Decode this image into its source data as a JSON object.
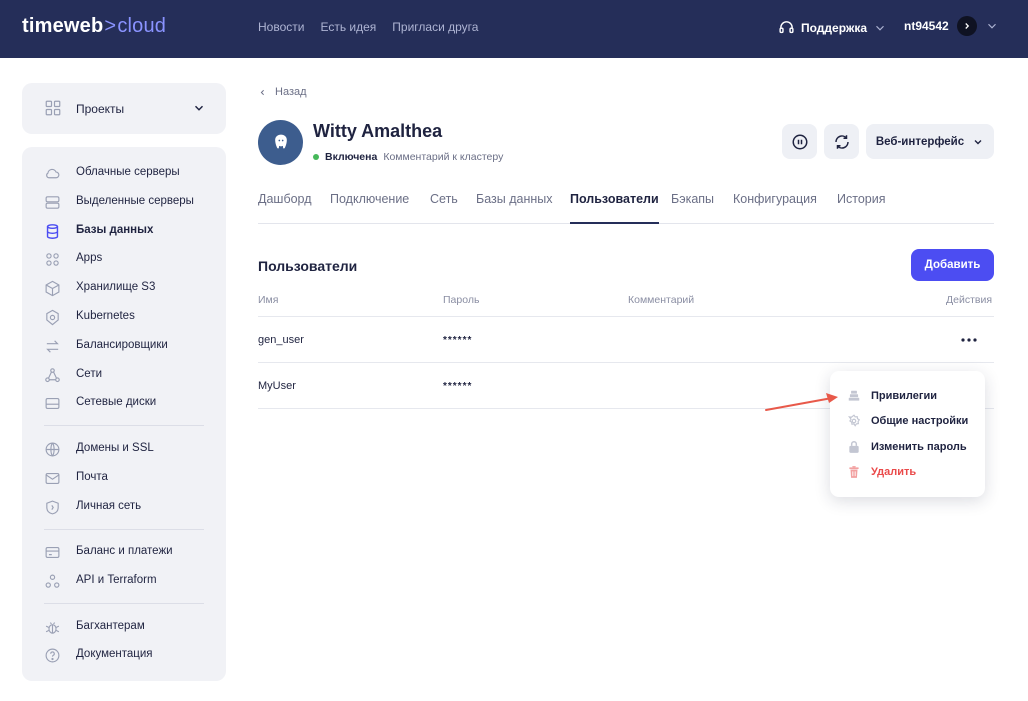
{
  "header": {
    "logo_main": "timeweb",
    "logo_sep": ">",
    "logo_cloud": "cloud",
    "nav": [
      "Новости",
      "Есть идея",
      "Пригласи друга"
    ],
    "support_label": "Поддержка",
    "username": "nt94542"
  },
  "sidebar": {
    "projects_label": "Проекты",
    "items": [
      {
        "label": "Облачные серверы",
        "icon": "cloud-icon"
      },
      {
        "label": "Выделенные серверы",
        "icon": "server-icon"
      },
      {
        "label": "Базы данных",
        "icon": "database-icon",
        "active": true
      },
      {
        "label": "Apps",
        "icon": "apps-icon"
      },
      {
        "label": "Хранилище S3",
        "icon": "box-icon"
      },
      {
        "label": "Kubernetes",
        "icon": "kubernetes-icon"
      },
      {
        "label": "Балансировщики",
        "icon": "arrows-icon"
      },
      {
        "label": "Сети",
        "icon": "network-icon"
      },
      {
        "label": "Сетевые диски",
        "icon": "disk-icon"
      },
      {
        "label": "Домены и SSL",
        "icon": "globe-icon"
      },
      {
        "label": "Почта",
        "icon": "mail-icon"
      },
      {
        "label": "Личная сеть",
        "icon": "shield-icon"
      },
      {
        "label": "Баланс и платежи",
        "icon": "card-icon"
      },
      {
        "label": "API и Terraform",
        "icon": "api-icon"
      },
      {
        "label": "Багхантерам",
        "icon": "bug-icon"
      },
      {
        "label": "Документация",
        "icon": "help-icon"
      }
    ]
  },
  "main": {
    "back_label": "Назад",
    "cluster_name": "Witty Amalthea",
    "status_label": "Включена",
    "comment_label": "Комментарий к кластеру",
    "web_button_label": "Веб-интерфейс",
    "tabs": [
      "Дашборд",
      "Подключение",
      "Сеть",
      "Базы данных",
      "Пользователи",
      "Бэкапы",
      "Конфигурация",
      "История"
    ],
    "active_tab": "Пользователи",
    "section_title": "Пользователи",
    "add_button_label": "Добавить",
    "table": {
      "headers": [
        "Имя",
        "Пароль",
        "Комментарий",
        "Действия"
      ],
      "rows": [
        {
          "name": "gen_user",
          "password": "******",
          "comment": ""
        },
        {
          "name": "MyUser",
          "password": "******",
          "comment": ""
        }
      ]
    },
    "dropdown": {
      "items": [
        {
          "label": "Привилегии",
          "icon": "privileges-icon"
        },
        {
          "label": "Общие настройки",
          "icon": "gear-icon"
        },
        {
          "label": "Изменить пароль",
          "icon": "lock-icon"
        },
        {
          "label": "Удалить",
          "icon": "trash-icon",
          "danger": true
        }
      ]
    }
  },
  "colors": {
    "header_bg": "#252e59",
    "accent": "#4c4df2",
    "status_green": "#46b85a",
    "danger": "#ea4a4a",
    "annotation_arrow": "#e8594a"
  }
}
